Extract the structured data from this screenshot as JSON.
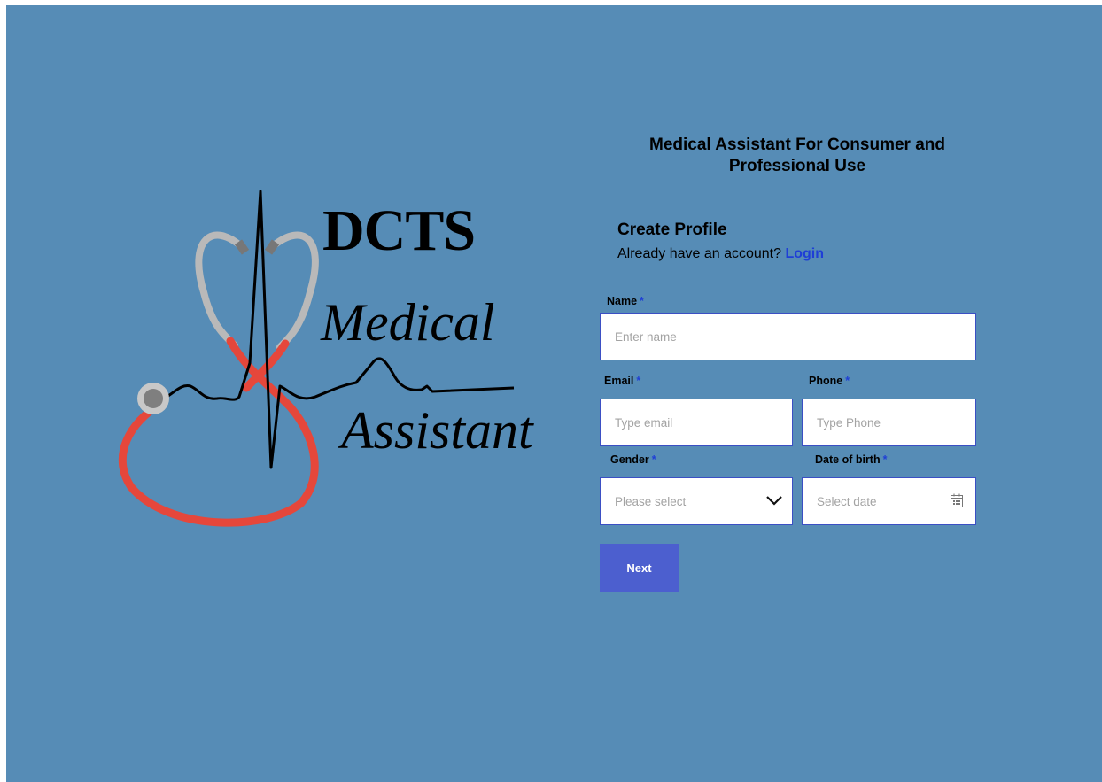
{
  "logo": {
    "brand": "DCTS",
    "line1": "Medical",
    "line2": "Assistant"
  },
  "heading": "Medical Assistant For Consumer and Professional Use",
  "form": {
    "title": "Create Profile",
    "login_prompt": "Already have an account?",
    "login_link": "Login",
    "required_marker": "*",
    "name": {
      "label": "Name",
      "placeholder": "Enter name"
    },
    "email": {
      "label": "Email",
      "placeholder": "Type email"
    },
    "phone": {
      "label": "Phone",
      "placeholder": "Type Phone"
    },
    "gender": {
      "label": "Gender",
      "placeholder": "Please select"
    },
    "dob": {
      "label": "Date of birth",
      "placeholder": "Select date"
    },
    "next_label": "Next"
  },
  "colors": {
    "background": "#568cb6",
    "accent": "#4c5fcf",
    "link": "#1f3fd6",
    "field_border": "#3b4fc4"
  },
  "icons": {
    "gender_dropdown": "chevron-down-icon",
    "dob_picker": "calendar-icon"
  }
}
